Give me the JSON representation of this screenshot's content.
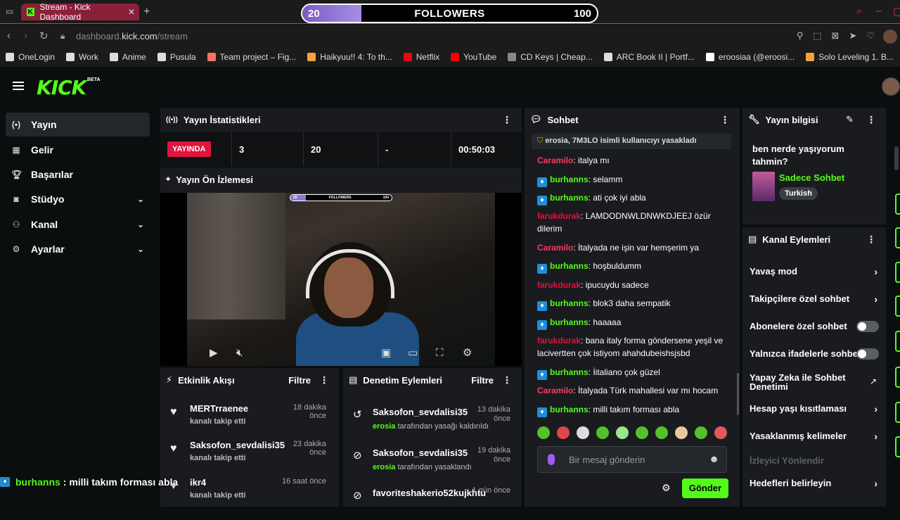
{
  "browser": {
    "tab_title": "Stream - Kick Dashboard",
    "url_prefix": "dashboard.",
    "url_domain": "kick.com",
    "url_path": "/stream"
  },
  "follower_goal": {
    "current": "20",
    "label": "FOLLOWERS",
    "target": "100",
    "progress": 0.2
  },
  "bookmarks": [
    "OneLogin",
    "Work",
    "Anime",
    "Pusula",
    "Team project – Fig...",
    "Haikyuu!! 4: To th...",
    "Netflix",
    "YouTube",
    "CD Keys | Cheap...",
    "ARC Book II | Portf...",
    "eroosiaa (@eroosi...",
    "Solo Leveling 1. B..."
  ],
  "brand": {
    "logo": "KICK",
    "beta": "BETA"
  },
  "sidebar": {
    "items": [
      {
        "label": "Yayın",
        "icon": "broadcast-icon"
      },
      {
        "label": "Gelir",
        "icon": "chart-icon"
      },
      {
        "label": "Başarılar",
        "icon": "trophy-icon"
      },
      {
        "label": "Stüdyo",
        "icon": "studio-icon"
      },
      {
        "label": "Kanal",
        "icon": "users-icon"
      },
      {
        "label": "Ayarlar",
        "icon": "gear-icon"
      }
    ]
  },
  "stats_panel": {
    "title": "Yayın İstatistikleri",
    "live_label": "YAYINDA",
    "viewers": "3",
    "followers": "20",
    "subs": "-",
    "duration": "00:50:03"
  },
  "preview_panel": {
    "title": "Yayın Ön İzlemesi",
    "mini_low": "20",
    "mini_label": "FOLLOWERS",
    "mini_high": "100"
  },
  "activity": {
    "title": "Etkinlik Akışı",
    "filter": "Filtre",
    "items": [
      {
        "name": "MERTrraenee",
        "action": "kanalı takip etti",
        "time": "18 dakika önce"
      },
      {
        "name": "Saksofon_sevdalisi35",
        "action": "kanalı takip etti",
        "time": "23 dakika önce"
      },
      {
        "name": "ikr4",
        "action": "kanalı takip etti",
        "time": "16 saat önce"
      }
    ]
  },
  "moderation": {
    "title": "Denetim Eylemleri",
    "filter": "Filtre",
    "items": [
      {
        "name": "Saksofon_sevdalisi35",
        "by": "erosia",
        "action": "tarafından yasağı kaldırıldı",
        "time": "13 dakika önce"
      },
      {
        "name": "Saksofon_sevdalisi35",
        "by": "erosia",
        "action": "tarafından yasaklandı",
        "time": "19 dakika önce"
      },
      {
        "name": "favoriteshakerio52kujkhtu",
        "by": "",
        "action": "",
        "time": "1 gün önce"
      }
    ]
  },
  "chat": {
    "title": "Sohbet",
    "system_msg": "erosia, 7M3LO isimli kullanıcıyı yasakladı",
    "messages": [
      {
        "user": "Caramilo",
        "text": "italya mı",
        "color": "#ff3b5c",
        "badge": false
      },
      {
        "user": "burhanns",
        "text": "selamm",
        "color": "#53fc18",
        "badge": true
      },
      {
        "user": "burhanns",
        "text": "ati çok iyi abla",
        "color": "#53fc18",
        "badge": true
      },
      {
        "user": "farukdurak",
        "text": "LAMDODNWLDNWKDJEEJ özür dilerim",
        "color": "#e0143c",
        "badge": false
      },
      {
        "user": "Caramilo",
        "text": "İtalyada ne işin var hemşerim ya",
        "color": "#ff3b5c",
        "badge": false
      },
      {
        "user": "burhanns",
        "text": "hoşbuldumm",
        "color": "#53fc18",
        "badge": true
      },
      {
        "user": "farukdurak",
        "text": "ipucuydu sadece",
        "color": "#e0143c",
        "badge": false
      },
      {
        "user": "burhanns",
        "text": "blok3 daha sempatik",
        "color": "#53fc18",
        "badge": true
      },
      {
        "user": "burhanns",
        "text": "haaaaa",
        "color": "#53fc18",
        "badge": true
      },
      {
        "user": "farukdurak",
        "text": "bana italy forma göndersene yeşil ve lacivertten çok istiyom ahahdubeishsjsbd",
        "color": "#e0143c",
        "badge": false
      },
      {
        "user": "burhanns",
        "text": "İitaliano çok güzel",
        "color": "#53fc18",
        "badge": true
      },
      {
        "user": "Caramilo",
        "text": "İtalyada Türk mahallesi var mı hocam",
        "color": "#ff3b5c",
        "badge": false
      },
      {
        "user": "burhanns",
        "text": "milli takım forması abla",
        "color": "#53fc18",
        "badge": true
      }
    ],
    "input_placeholder": "Bir mesaj gönderin",
    "send_label": "Gönder"
  },
  "stream_info": {
    "title": "Yayın bilgisi",
    "stream_title": "ben nerde yaşıyorum tahmin?",
    "category": "Sadece Sohbet",
    "language": "Turkish"
  },
  "channel_actions": {
    "title": "Kanal Eylemleri",
    "items": [
      {
        "label": "Yavaş mod",
        "kind": "arrow"
      },
      {
        "label": "Takipçilere özel sohbet",
        "kind": "arrow"
      },
      {
        "label": "Abonelere özel sohbet",
        "kind": "toggle"
      },
      {
        "label": "Yalnızca ifadelerle sohbet",
        "kind": "toggle"
      },
      {
        "label": "Yapay Zeka ile Sohbet Denetimi",
        "kind": "external"
      },
      {
        "label": "Hesap yaşı kısıtlaması",
        "kind": "arrow"
      },
      {
        "label": "Yasaklanmış kelimeler",
        "kind": "arrow"
      },
      {
        "label": "İzleyici Yönlendir",
        "kind": "disabled"
      },
      {
        "label": "Hedefleri belirleyin",
        "kind": "arrow"
      }
    ]
  },
  "overlay_chat": {
    "user": "burhanns",
    "text": ": milli takım forması abla"
  }
}
